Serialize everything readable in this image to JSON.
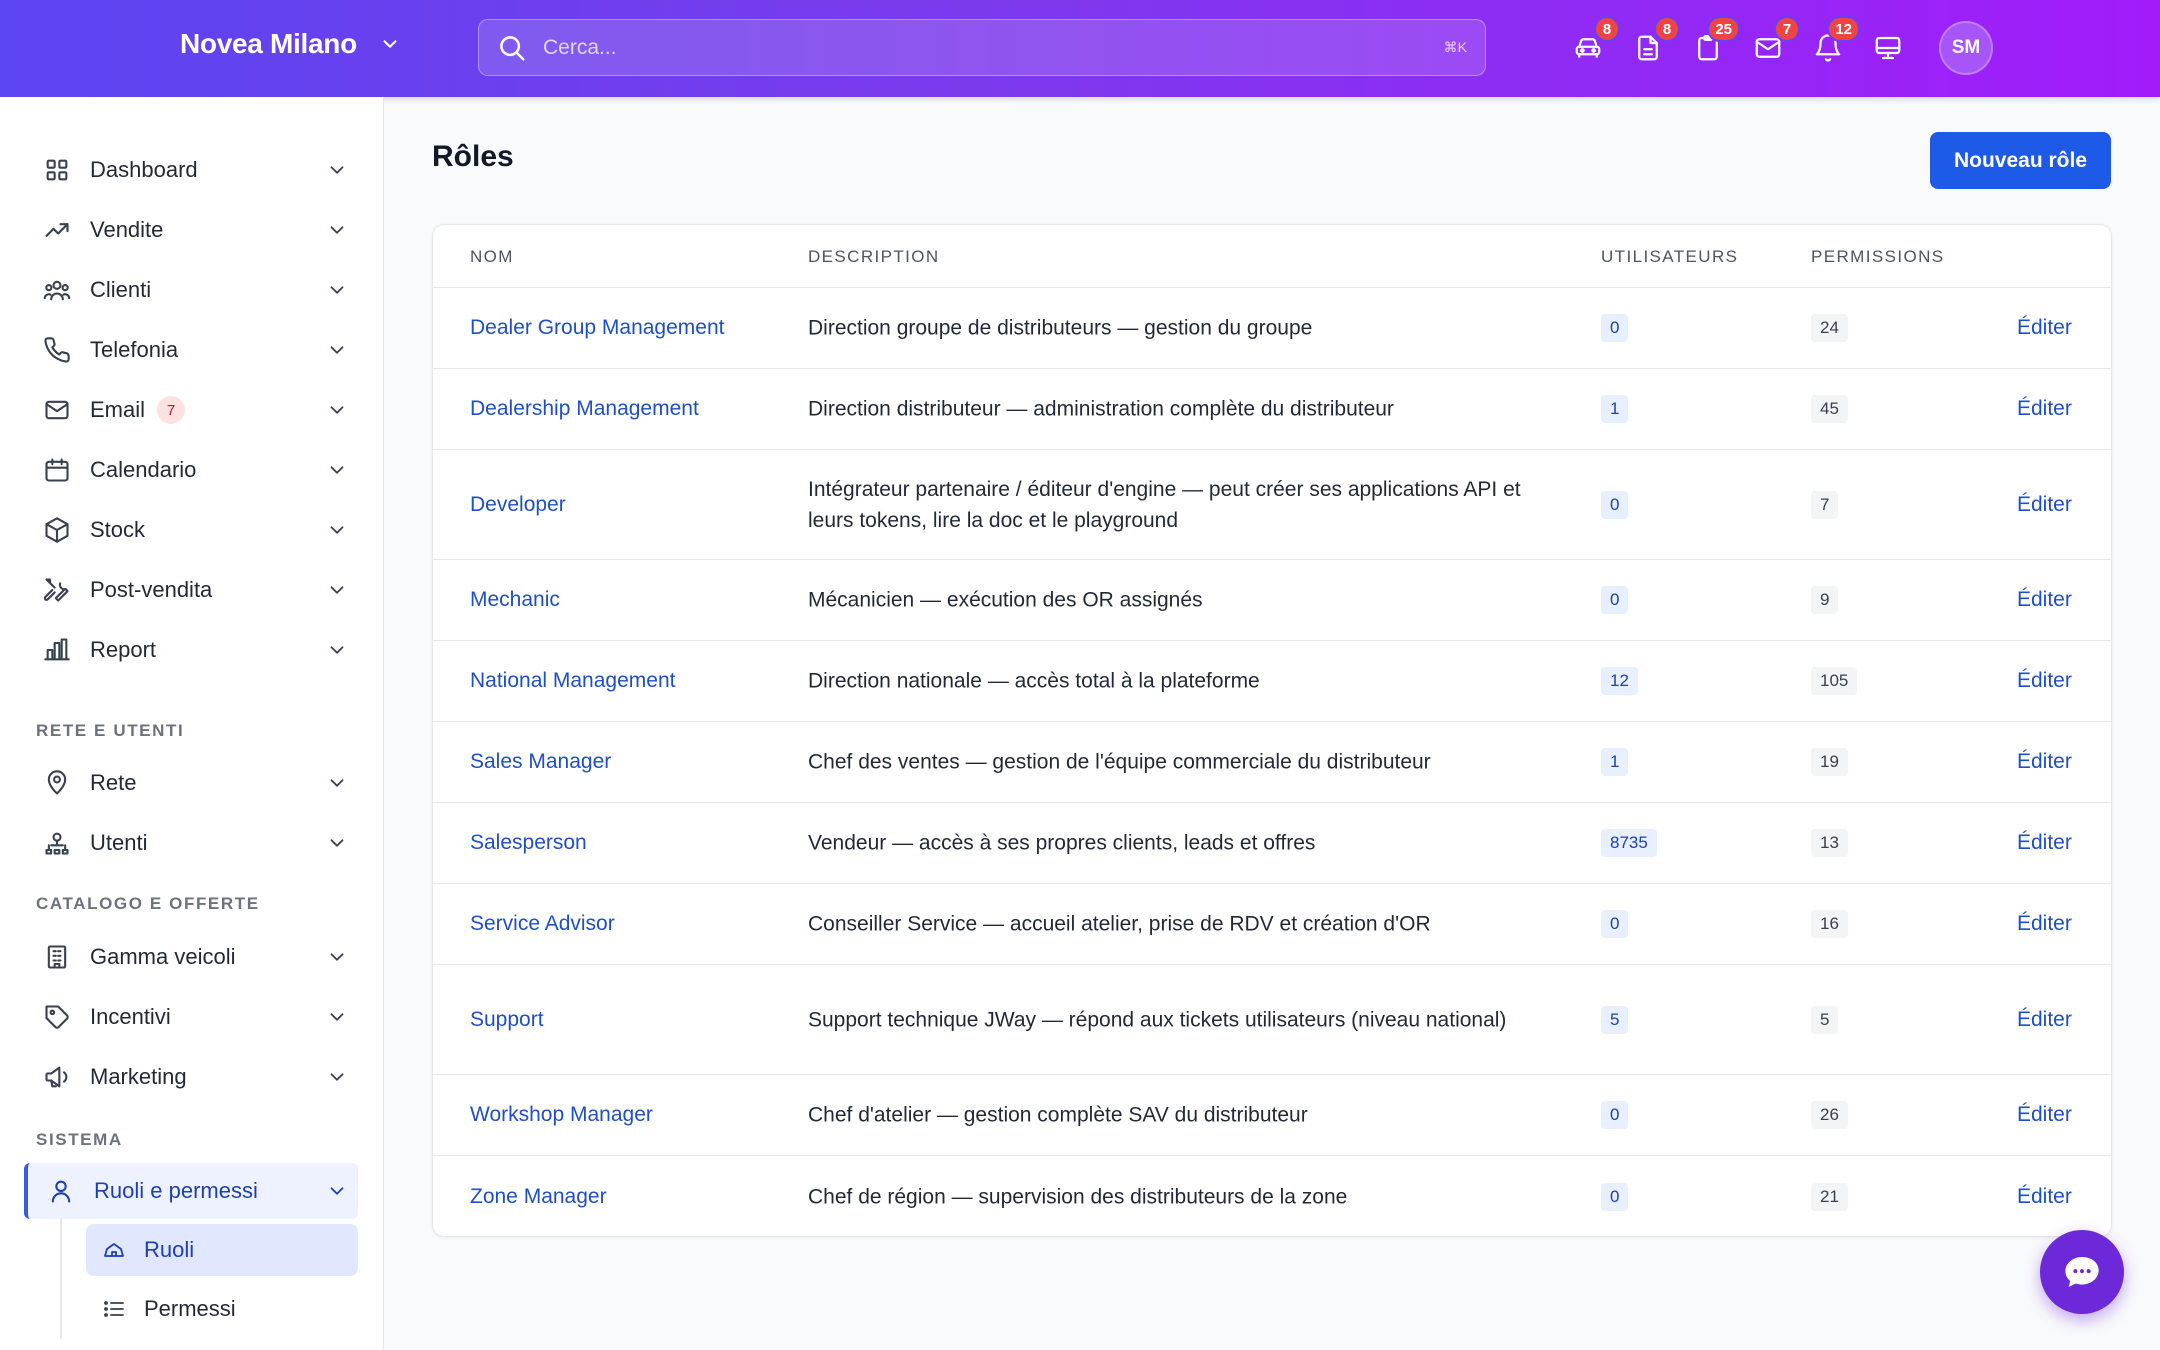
{
  "header": {
    "brand": "Novea Milano",
    "search_placeholder": "Cerca...",
    "search_shortcut": "⌘K",
    "icons": [
      {
        "name": "car-icon",
        "badge": "8"
      },
      {
        "name": "document-icon",
        "badge": "8"
      },
      {
        "name": "clipboard-icon",
        "badge": "25"
      },
      {
        "name": "mail-icon",
        "badge": "7"
      },
      {
        "name": "bell-icon",
        "badge": "12"
      },
      {
        "name": "monitor-icon",
        "badge": ""
      }
    ],
    "avatar": "SM"
  },
  "sidebar": {
    "items": [
      {
        "label": "Dashboard",
        "icon": "grid-icon"
      },
      {
        "label": "Vendite",
        "icon": "trend-icon"
      },
      {
        "label": "Clienti",
        "icon": "users-icon"
      },
      {
        "label": "Telefonia",
        "icon": "phone-icon"
      },
      {
        "label": "Email",
        "icon": "mail-icon",
        "badge": "7"
      },
      {
        "label": "Calendario",
        "icon": "calendar-icon"
      },
      {
        "label": "Stock",
        "icon": "box-icon"
      },
      {
        "label": "Post-vendita",
        "icon": "tools-icon"
      },
      {
        "label": "Report",
        "icon": "chart-icon"
      }
    ],
    "section_network": "RETE E UTENTI",
    "network_items": [
      {
        "label": "Rete",
        "icon": "pin-icon"
      },
      {
        "label": "Utenti",
        "icon": "user-tree-icon"
      }
    ],
    "section_catalog": "CATALOGO E OFFERTE",
    "catalog_items": [
      {
        "label": "Gamma veicoli",
        "icon": "building-icon"
      },
      {
        "label": "Incentivi",
        "icon": "tag-icon"
      },
      {
        "label": "Marketing",
        "icon": "megaphone-icon"
      }
    ],
    "section_system": "SISTEMA",
    "system_item": {
      "label": "Ruoli e permessi",
      "icon": "user-icon"
    },
    "sub_items": [
      {
        "label": "Ruoli",
        "icon": "home-icon"
      },
      {
        "label": "Permessi",
        "icon": "list-icon"
      }
    ]
  },
  "main": {
    "title": "Rôles",
    "new_button": "Nouveau rôle",
    "columns": [
      "NOM",
      "DESCRIPTION",
      "UTILISATEURS",
      "PERMISSIONS"
    ],
    "edit_label": "Éditer",
    "rows": [
      {
        "name": "Dealer Group Management",
        "description": "Direction groupe de distributeurs — gestion du groupe",
        "users": "0",
        "permissions": "24"
      },
      {
        "name": "Dealership Management",
        "description": "Direction distributeur — administration complète du distributeur",
        "users": "1",
        "permissions": "45"
      },
      {
        "name": "Developer",
        "description": "Intégrateur partenaire / éditeur d'engine — peut créer ses applications API et leurs tokens, lire la doc et le playground",
        "users": "0",
        "permissions": "7"
      },
      {
        "name": "Mechanic",
        "description": "Mécanicien — exécution des OR assignés",
        "users": "0",
        "permissions": "9"
      },
      {
        "name": "National Management",
        "description": "Direction nationale — accès total à la plateforme",
        "users": "12",
        "permissions": "105"
      },
      {
        "name": "Sales Manager",
        "description": "Chef des ventes — gestion de l'équipe commerciale du distributeur",
        "users": "1",
        "permissions": "19"
      },
      {
        "name": "Salesperson",
        "description": "Vendeur — accès à ses propres clients, leads et offres",
        "users": "8735",
        "permissions": "13"
      },
      {
        "name": "Service Advisor",
        "description": "Conseiller Service — accueil atelier, prise de RDV et création d'OR",
        "users": "0",
        "permissions": "16"
      },
      {
        "name": "Support",
        "description": "Support technique JWay — répond aux tickets utilisateurs (niveau national)",
        "users": "5",
        "permissions": "5"
      },
      {
        "name": "Workshop Manager",
        "description": "Chef d'atelier — gestion complète SAV du distributeur",
        "users": "0",
        "permissions": "26"
      },
      {
        "name": "Zone Manager",
        "description": "Chef de région — supervision des distributeurs de la zone",
        "users": "0",
        "permissions": "21"
      }
    ]
  }
}
